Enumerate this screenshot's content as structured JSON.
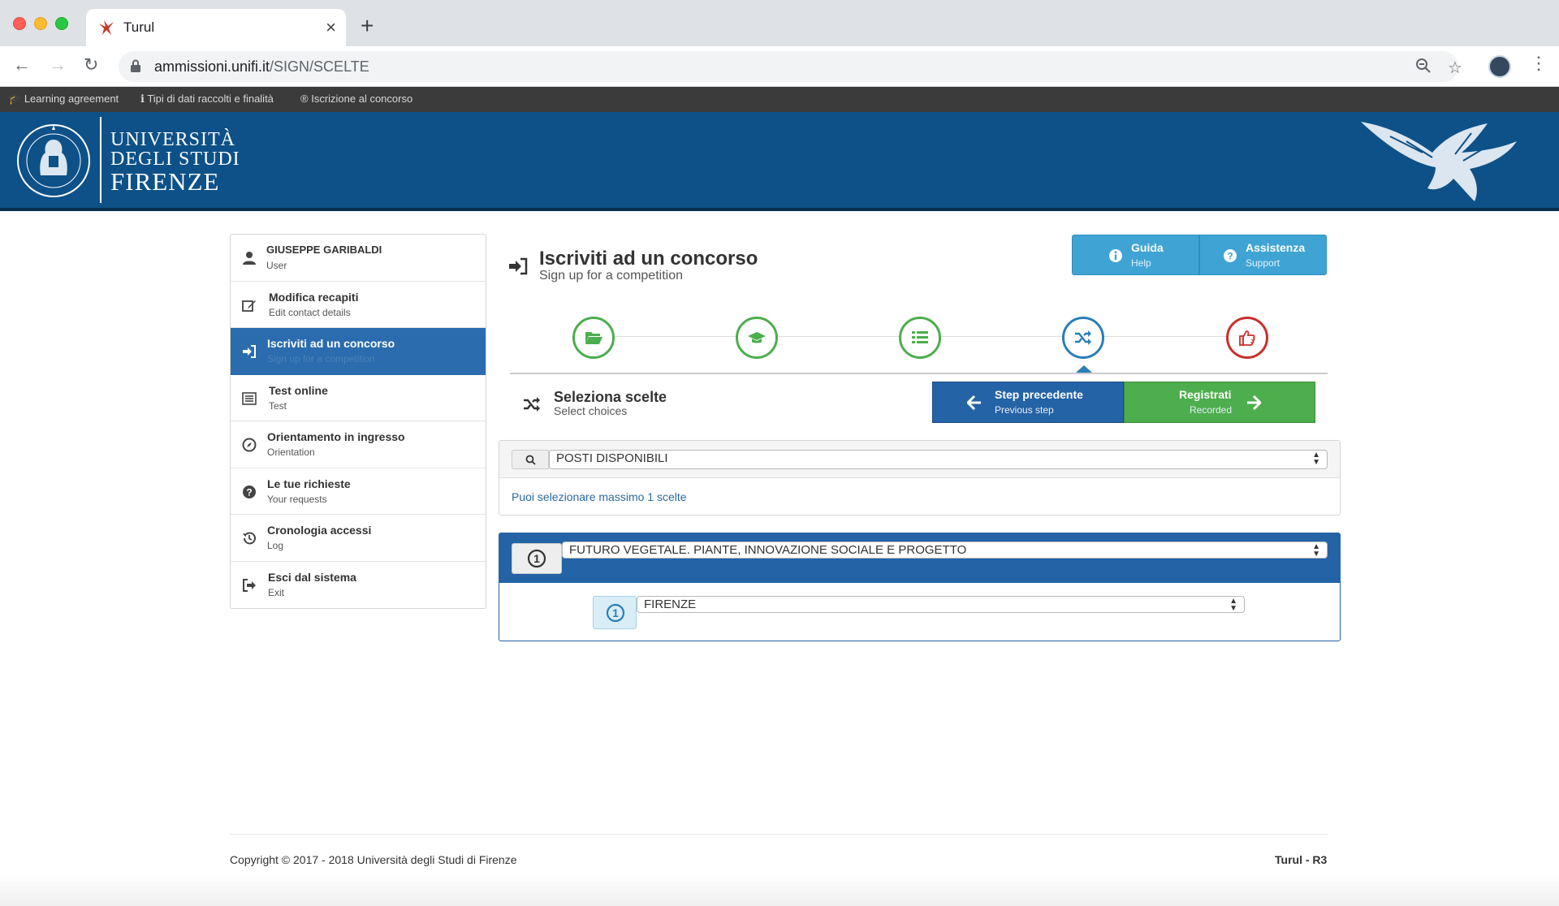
{
  "browser": {
    "tab_title": "Turul",
    "url_domain": "ammissioni.unifi.it",
    "url_path": "/SIGN/SCELTE",
    "new_tab_label": "+",
    "close_label": "×"
  },
  "strip": {
    "items": [
      "Learning agreement",
      "Tipi di dati raccolti e finalità",
      "Iscrizione al concorso"
    ]
  },
  "header": {
    "line1": "UNIVERSITÀ",
    "line2": "DEGLI STUDI",
    "line3": "FIRENZE",
    "seal_text": "FLORENTINA STUDIORUM UNIVERSITAS"
  },
  "sidebar": {
    "items": [
      {
        "label": "GIUSEPPE GARIBALDI",
        "sub": "User",
        "icon": "user-icon"
      },
      {
        "label": "Modifica recapiti",
        "sub": "Edit contact details",
        "icon": "edit-icon"
      },
      {
        "label": "Iscriviti ad un concorso",
        "sub": "Sign up for a competition",
        "icon": "sign-in-icon"
      },
      {
        "label": "Test online",
        "sub": "Test",
        "icon": "list-icon"
      },
      {
        "label": "Orientamento in ingresso",
        "sub": "Orientation",
        "icon": "compass-icon"
      },
      {
        "label": "Le tue richieste",
        "sub": "Your requests",
        "icon": "question-icon"
      },
      {
        "label": "Cronologia accessi",
        "sub": "Log",
        "icon": "history-icon"
      },
      {
        "label": "Esci dal sistema",
        "sub": "Exit",
        "icon": "sign-out-icon"
      }
    ],
    "active_index": 2
  },
  "main": {
    "title": "Iscriviti ad un concorso",
    "subtitle": "Sign up for a competition",
    "help": {
      "label": "Guida",
      "sub": "Help"
    },
    "support": {
      "label": "Assistenza",
      "sub": "Support"
    },
    "steps": [
      "folder-open-icon",
      "graduation-cap-icon",
      "list-icon",
      "random-icon",
      "thumbs-up-icon"
    ],
    "current_step": 4,
    "section_title": "Seleziona scelte",
    "section_sub": "Select choices",
    "prev_btn": {
      "label": "Step precedente",
      "sub": "Previous step"
    },
    "next_btn": {
      "label": "Registrati",
      "sub": "Recorded"
    },
    "filter_select": "POSTI DISPONIBILI",
    "info": "Puoi selezionare massimo 1 scelte",
    "choice_select": "FUTURO VEGETALE. PIANTE, INNOVAZIONE SOCIALE E PROGETTO",
    "sede_select": "FIRENZE",
    "choice_number": "1"
  },
  "footer": {
    "copyright": "Copyright © 2017 - 2018 Università degli Studi di Firenze",
    "version": "Turul - R3"
  },
  "colors": {
    "header_blue": "#0d5188",
    "active_blue": "#2a6cae",
    "green": "#4cae4c",
    "red": "#c9302c",
    "help_blue": "#3fa4d4"
  }
}
